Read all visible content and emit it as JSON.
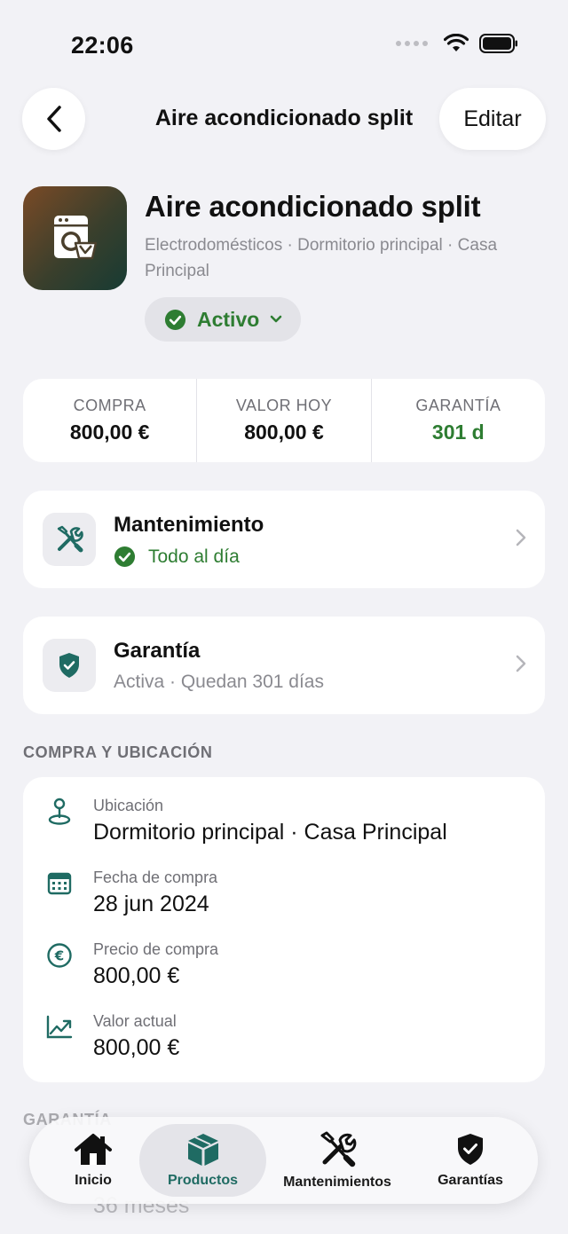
{
  "status_bar": {
    "time": "22:06"
  },
  "nav": {
    "title": "Aire acondicionado split",
    "edit_label": "Editar"
  },
  "product": {
    "name": "Aire acondicionado split",
    "subtitle": "Electrodomésticos · Dormitorio principal · Casa Principal",
    "status": "Activo"
  },
  "stats": [
    {
      "label": "COMPRA",
      "value": "800,00 €"
    },
    {
      "label": "VALOR HOY",
      "value": "800,00 €"
    },
    {
      "label": "GARANTÍA",
      "value": "301 d"
    }
  ],
  "maintenance": {
    "title": "Mantenimiento",
    "status": "Todo al día"
  },
  "warranty": {
    "title": "Garantía",
    "status": "Activa · Quedan 301 días"
  },
  "purchase_section": {
    "header": "COMPRA Y UBICACIÓN",
    "items": [
      {
        "label": "Ubicación",
        "value": "Dormitorio principal · Casa Principal",
        "icon": "location-pin-icon"
      },
      {
        "label": "Fecha de compra",
        "value": "28 jun 2024",
        "icon": "calendar-icon"
      },
      {
        "label": "Precio de compra",
        "value": "800,00 €",
        "icon": "euro-icon"
      },
      {
        "label": "Valor actual",
        "value": "800,00 €",
        "icon": "trend-chart-icon"
      }
    ]
  },
  "warranty_section": {
    "header": "GARANTÍA",
    "value": "36 meses"
  },
  "tabs": [
    {
      "label": "Inicio",
      "icon": "home-icon"
    },
    {
      "label": "Productos",
      "icon": "box-icon",
      "active": true
    },
    {
      "label": "Mantenimientos",
      "icon": "tools-icon"
    },
    {
      "label": "Garantías",
      "icon": "shield-check-icon"
    }
  ],
  "colors": {
    "accent_green": "#2e7d32",
    "teal": "#1f6b63",
    "background": "#f2f2f6"
  }
}
